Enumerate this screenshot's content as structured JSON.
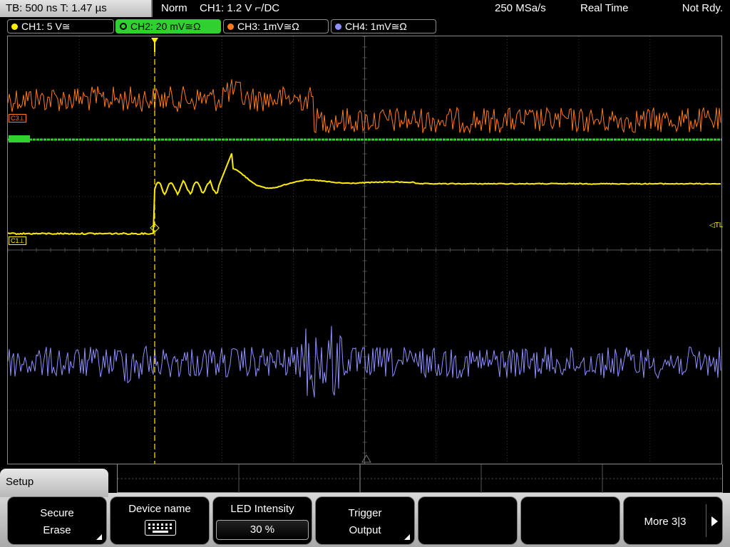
{
  "topbar": {
    "timebase": "TB: 500 ns   T: 1.47 µs",
    "mode": "Norm",
    "trigger": "CH1: 1.2 V ⌐/DC",
    "sample_rate": "250 MSa/s",
    "acquisition": "Real Time",
    "state": "Not Rdy."
  },
  "channels": [
    {
      "label": "CH1: 5 V≅",
      "color": "#ffee00",
      "active": false
    },
    {
      "label": "CH2: 20 mV≅Ω",
      "color": "#2ed12e",
      "active": true
    },
    {
      "label": "CH3: 1mV≅Ω",
      "color": "#ff7a1a",
      "active": false
    },
    {
      "label": "CH4: 1mV≅Ω",
      "color": "#8f8fff",
      "active": false
    }
  ],
  "markers": {
    "c3": "C3⊥",
    "c2": "C2",
    "c1": "C1⊥",
    "trigger_level": "◁TL"
  },
  "menu": {
    "title": "Setup",
    "softkeys": {
      "secure_erase": {
        "line1": "Secure",
        "line2": "Erase"
      },
      "device_name": {
        "line1": "Device name"
      },
      "led_intensity": {
        "line1": "LED Intensity",
        "value": "30 %"
      },
      "trigger_output": {
        "line1": "Trigger",
        "line2": "Output"
      },
      "more": {
        "line1": "More 3|3"
      }
    }
  },
  "colors": {
    "ch1": "#ffee00",
    "ch2": "#2ed12e",
    "ch3": "#ff7a1a",
    "ch4": "#8f8fff",
    "grid": "#5a5a5a"
  }
}
